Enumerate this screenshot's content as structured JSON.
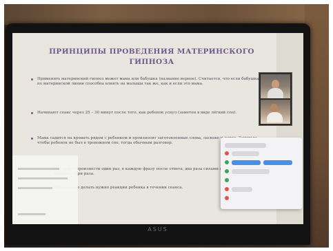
{
  "photo": {
    "description_free": true
  },
  "slide": {
    "title_line1": "ПРИНЦИПЫ ПРОВЕДЕНИЯ МАТЕРИНСКОГО",
    "title_line2": "ГИПНОЗА",
    "bullets": [
      "Применять материнский гипноз может мама или бабушка (название верное). Считается, что если бабушка по материнской линии способна влиять на малыша так же, как и если это мама.",
      "Начинают сеанс через 25 – 30 минут после того, как ребенок уснул (заметен в виде лёгкий сон).",
      "Мама садится на кровать рядом с ребенком и произносит заготовленные слова, ласково и четко. Заметьте, чтобы ребенок не был в тревожном сне, тогда обычным разговор.",
      "Мы нужно произнести один раз, в каждую фразу после ответа, два раза силами вслух, в конце — три раза.",
      "Наблюдение делать нужно реакции ребенка в течении сеанса."
    ]
  },
  "laptop": {
    "brand": "ASUS"
  }
}
